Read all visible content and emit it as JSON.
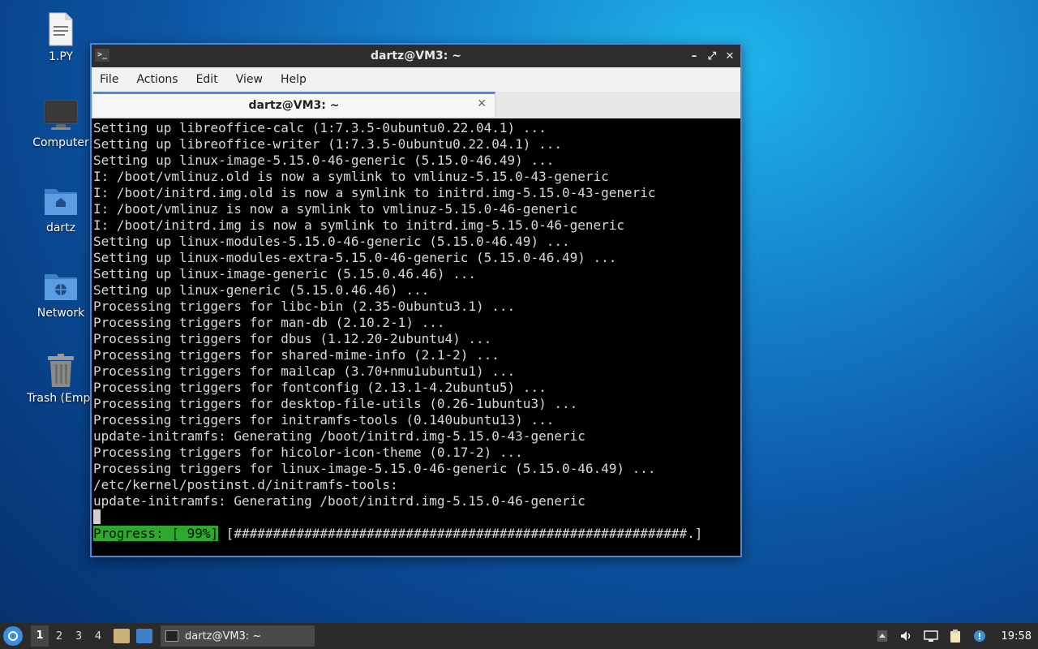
{
  "desktop": {
    "icons": [
      {
        "label": "1.PY",
        "icon": "text-file-icon"
      },
      {
        "label": "Computer",
        "icon": "computer-icon"
      },
      {
        "label": "dartz",
        "icon": "home-folder-icon"
      },
      {
        "label": "Network",
        "icon": "network-folder-icon"
      },
      {
        "label": "Trash (Empt",
        "icon": "trash-icon"
      }
    ]
  },
  "window": {
    "title": "dartz@VM3: ~",
    "controls": {
      "minimize": "–",
      "maximize": "⤢",
      "close": "✕"
    },
    "menu": [
      "File",
      "Actions",
      "Edit",
      "View",
      "Help"
    ],
    "tab": {
      "label": "dartz@VM3: ~",
      "close": "✕"
    }
  },
  "terminal": {
    "lines": [
      "Setting up libreoffice-calc (1:7.3.5-0ubuntu0.22.04.1) ...",
      "Setting up libreoffice-writer (1:7.3.5-0ubuntu0.22.04.1) ...",
      "Setting up linux-image-5.15.0-46-generic (5.15.0-46.49) ...",
      "I: /boot/vmlinuz.old is now a symlink to vmlinuz-5.15.0-43-generic",
      "I: /boot/initrd.img.old is now a symlink to initrd.img-5.15.0-43-generic",
      "I: /boot/vmlinuz is now a symlink to vmlinuz-5.15.0-46-generic",
      "I: /boot/initrd.img is now a symlink to initrd.img-5.15.0-46-generic",
      "Setting up linux-modules-5.15.0-46-generic (5.15.0-46.49) ...",
      "Setting up linux-modules-extra-5.15.0-46-generic (5.15.0-46.49) ...",
      "Setting up linux-image-generic (5.15.0.46.46) ...",
      "Setting up linux-generic (5.15.0.46.46) ...",
      "Processing triggers for libc-bin (2.35-0ubuntu3.1) ...",
      "Processing triggers for man-db (2.10.2-1) ...",
      "Processing triggers for dbus (1.12.20-2ubuntu4) ...",
      "Processing triggers for shared-mime-info (2.1-2) ...",
      "Processing triggers for mailcap (3.70+nmu1ubuntu1) ...",
      "Processing triggers for fontconfig (2.13.1-4.2ubuntu5) ...",
      "Processing triggers for desktop-file-utils (0.26-1ubuntu3) ...",
      "Processing triggers for initramfs-tools (0.140ubuntu13) ...",
      "update-initramfs: Generating /boot/initrd.img-5.15.0-43-generic",
      "Processing triggers for hicolor-icon-theme (0.17-2) ...",
      "Processing triggers for linux-image-5.15.0-46-generic (5.15.0-46.49) ...",
      "/etc/kernel/postinst.d/initramfs-tools:",
      "update-initramfs: Generating /boot/initrd.img-5.15.0-46-generic"
    ],
    "progress_label": "Progress: [ 99%]",
    "progress_bar": " [##########################################################.]",
    "progress_percent": 99
  },
  "taskbar": {
    "workspaces": [
      "1",
      "2",
      "3",
      "4"
    ],
    "active_workspace": "1",
    "task_label": "dartz@VM3: ~",
    "clock": "19:58"
  },
  "colors": {
    "accent": "#4d88d6",
    "progress_green": "#2fa82f"
  }
}
